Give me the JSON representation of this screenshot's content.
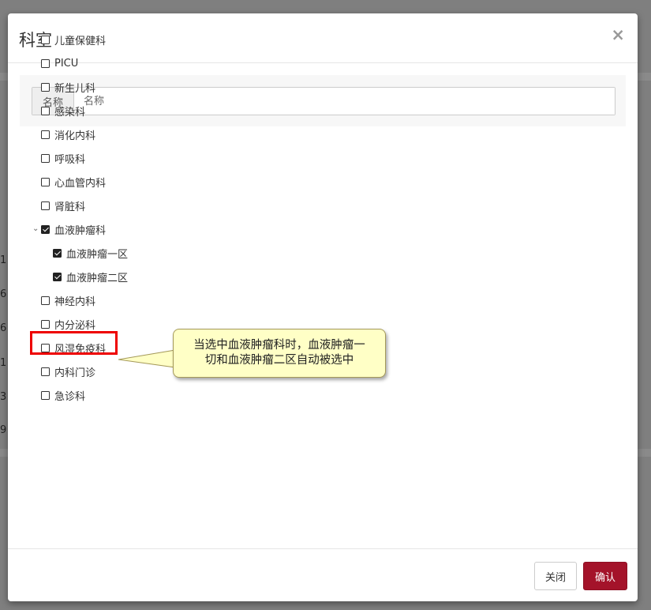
{
  "modal": {
    "title": "科室",
    "close_symbol": "×"
  },
  "search": {
    "label": "名称",
    "placeholder": "名称",
    "value": ""
  },
  "tree": [
    {
      "label": "儿童保健科",
      "checked": false,
      "level": 0
    },
    {
      "label": "PICU",
      "checked": false,
      "level": 0
    },
    {
      "label": "新生儿科",
      "checked": false,
      "level": 0
    },
    {
      "label": "感染科",
      "checked": false,
      "level": 0
    },
    {
      "label": "消化内科",
      "checked": false,
      "level": 0
    },
    {
      "label": "呼吸科",
      "checked": false,
      "level": 0
    },
    {
      "label": "心血管内科",
      "checked": false,
      "level": 0
    },
    {
      "label": "肾脏科",
      "checked": false,
      "level": 0
    },
    {
      "label": "血液肿瘤科",
      "checked": true,
      "level": 0,
      "expanded": true
    },
    {
      "label": "血液肿瘤一区",
      "checked": true,
      "level": 1
    },
    {
      "label": "血液肿瘤二区",
      "checked": true,
      "level": 1
    },
    {
      "label": "神经内科",
      "checked": false,
      "level": 0
    },
    {
      "label": "内分泌科",
      "checked": false,
      "level": 0
    },
    {
      "label": "风湿免疫科",
      "checked": false,
      "level": 0
    },
    {
      "label": "内科门诊",
      "checked": false,
      "level": 0
    },
    {
      "label": "急诊科",
      "checked": false,
      "level": 0
    }
  ],
  "callout": {
    "line1": "当选中血液肿瘤科时，血液肿瘤一",
    "line2": "切和血液肿瘤二区自动被选中"
  },
  "footer": {
    "close_label": "关闭",
    "confirm_label": "确认"
  },
  "colors": {
    "confirm": "#a4132a",
    "highlight": "#ee0000",
    "callout_bg": "#ffffc6"
  },
  "background": {
    "row_digits": [
      "1",
      "6",
      "6",
      "1",
      "3",
      "9"
    ]
  }
}
